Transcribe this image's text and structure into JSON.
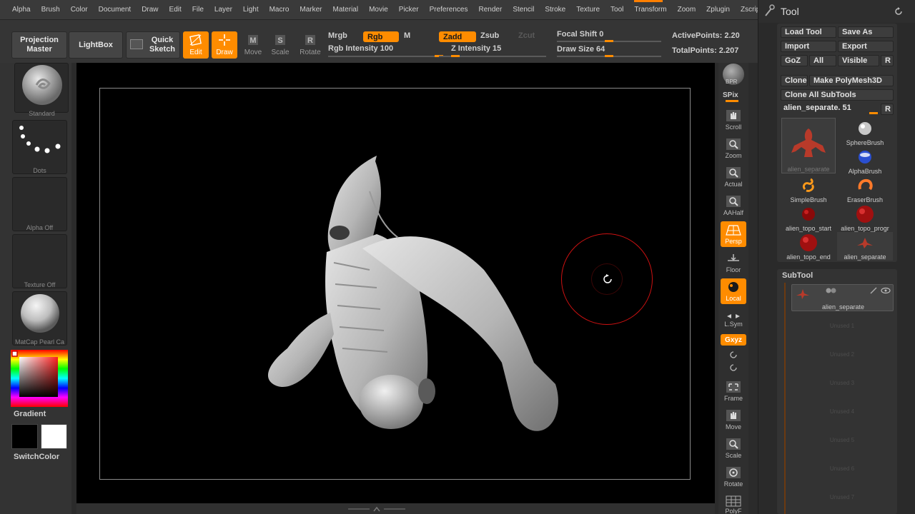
{
  "menubar": {
    "items": [
      "Alpha",
      "Brush",
      "Color",
      "Document",
      "Draw",
      "Edit",
      "File",
      "Layer",
      "Light",
      "Macro",
      "Marker",
      "Material",
      "Movie",
      "Picker",
      "Preferences",
      "Render",
      "Stencil",
      "Stroke",
      "Texture",
      "Tool",
      "Transform",
      "Zoom",
      "Zplugin",
      "Zscript"
    ]
  },
  "toolbar": {
    "projection_master": "Projection Master",
    "lightbox": "LightBox",
    "quick_sketch": "Quick Sketch",
    "edit": "Edit",
    "draw": "Draw",
    "move": "Move",
    "scale": "Scale",
    "rotate": "Rotate",
    "mrgb": "Mrgb",
    "rgb": "Rgb",
    "m": "M",
    "rgb_intensity": "Rgb Intensity 100",
    "rgb_intensity_value": 100,
    "zadd": "Zadd",
    "zsub": "Zsub",
    "zcut": "Zcut",
    "z_intensity": "Z Intensity 15",
    "z_intensity_value": 15,
    "focal_shift": "Focal Shift 0",
    "focal_shift_value": 0,
    "draw_size": "Draw Size 64",
    "draw_size_value": 64,
    "active_points": "ActivePoints: 2.20",
    "total_points": "TotalPoints: 2.207"
  },
  "leftshelf": {
    "brush_label": "Standard",
    "stroke_label": "Dots",
    "alpha_label": "Alpha Off",
    "texture_label": "Texture Off",
    "material_label": "MatCap Pearl Ca",
    "gradient_label": "Gradient",
    "switchcolor_label": "SwitchColor"
  },
  "rightshelf": {
    "bpr": "BPR",
    "spix": "SPix",
    "scroll": "Scroll",
    "zoom": "Zoom",
    "actual": "Actual",
    "aahalf": "AAHalf",
    "persp": "Persp",
    "floor": "Floor",
    "local": "Local",
    "lsym": "L.Sym",
    "xyz": "Gxyz",
    "frame": "Frame",
    "move": "Move",
    "scale": "Scale",
    "rotate": "Rotate",
    "polyf": "PolyF"
  },
  "toolpanel": {
    "title": "Tool",
    "load_tool": "Load Tool",
    "save_as": "Save As",
    "import": "Import",
    "export": "Export",
    "goz": "GoZ",
    "all": "All",
    "visible": "Visible",
    "r": "R",
    "clone": "Clone",
    "make_polymesh": "Make PolyMesh3D",
    "clone_all": "Clone All SubTools",
    "current_tool": "alien_separate. 51",
    "tools": [
      {
        "name": "alien_separate"
      },
      {
        "name": "SphereBrush"
      },
      {
        "name": "AlphaBrush"
      },
      {
        "name": "SimpleBrush"
      },
      {
        "name": "EraserBrush"
      },
      {
        "name": "alien_topo_start"
      },
      {
        "name": "alien_topo_progr"
      },
      {
        "name": "alien_topo_end"
      },
      {
        "name": "alien_separate"
      }
    ],
    "subtool_title": "SubTool",
    "subtool_active": "alien_separate",
    "subtool_unused": [
      "Unused 1",
      "Unused 2",
      "Unused 3",
      "Unused 4",
      "Unused 5",
      "Unused 6",
      "Unused 7"
    ]
  },
  "colors": {
    "accent": "#ff8c00",
    "brush_cursor": "#cc1111",
    "background": "#2b2b2b"
  }
}
